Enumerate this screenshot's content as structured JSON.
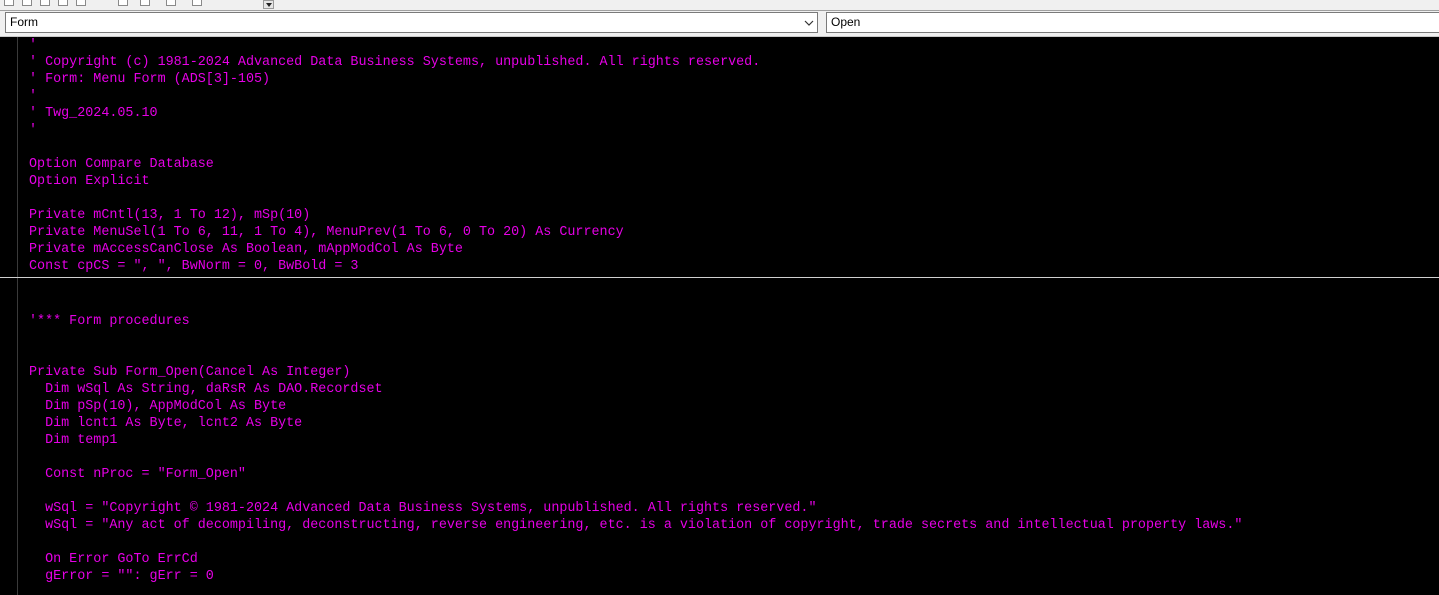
{
  "combos": {
    "object": "Form",
    "procedure": "Open"
  },
  "code_top": [
    "'",
    "' Copyright (c) 1981-2024 Advanced Data Business Systems, unpublished. All rights reserved.",
    "' Form: Menu Form (ADS[3]-105)",
    "'",
    "' Twg_2024.05.10",
    "'",
    "",
    "Option Compare Database",
    "Option Explicit",
    "",
    "Private mCntl(13, 1 To 12), mSp(10)",
    "Private MenuSel(1 To 6, 11, 1 To 4), MenuPrev(1 To 6, 0 To 20) As Currency",
    "Private mAccessCanClose As Boolean, mAppModCol As Byte",
    "Const cpCS = \", \", BwNorm = 0, BwBold = 3"
  ],
  "code_bottom": [
    "'*** Form procedures",
    "",
    "",
    "Private Sub Form_Open(Cancel As Integer)",
    "  Dim wSql As String, daRsR As DAO.Recordset",
    "  Dim pSp(10), AppModCol As Byte",
    "  Dim lcnt1 As Byte, lcnt2 As Byte",
    "  Dim temp1",
    "",
    "  Const nProc = \"Form_Open\"",
    "",
    "  wSql = \"Copyright © 1981-2024 Advanced Data Business Systems, unpublished. All rights reserved.\"",
    "  wSql = \"Any act of decompiling, deconstructing, reverse engineering, etc. is a violation of copyright, trade secrets and intellectual property laws.\"",
    "",
    "  On Error GoTo ErrCd",
    "  gError = \"\": gErr = 0"
  ],
  "colors": {
    "code_text": "#e600e6",
    "editor_background": "#000000",
    "toolbar_background": "#f0f0f0"
  },
  "icons": {
    "combo_dropdown": "chevron-down-icon",
    "toolbar_dropdown": "caret-down-icon"
  }
}
